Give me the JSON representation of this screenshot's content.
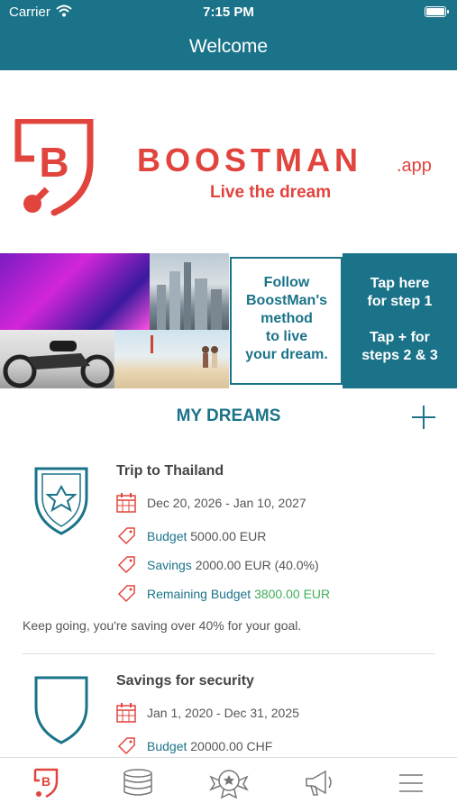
{
  "status_bar": {
    "carrier": "Carrier",
    "time": "7:15 PM"
  },
  "navbar": {
    "title": "Welcome"
  },
  "logo": {
    "brand": "BOOSTMAN",
    "suffix": ".app",
    "tagline": "Live the dream",
    "mark_letter": "B"
  },
  "banner": {
    "follow_lines": [
      "Follow",
      "BoostMan's",
      "method",
      "to live",
      "your dream."
    ],
    "tap_step1": [
      "Tap here",
      "for step 1"
    ],
    "tap_step23": [
      "Tap + for",
      "steps 2 & 3"
    ]
  },
  "dreams": {
    "header": "MY DREAMS",
    "items": [
      {
        "title": "Trip to Thailand",
        "dates": "Dec 20, 2026 - Jan 10, 2027",
        "budget_label": "Budget",
        "budget_value": "5000.00 EUR",
        "savings_label": "Savings",
        "savings_value": "2000.00 EUR (40.0%)",
        "remaining_label": "Remaining Budget",
        "remaining_value": "3800.00 EUR",
        "note": "Keep going, you're saving over 40% for your goal."
      },
      {
        "title": "Savings for security",
        "dates": "Jan 1, 2020 - Dec 31, 2025",
        "budget_label": "Budget",
        "budget_value": "20000.00 CHF"
      }
    ]
  },
  "tabbar": {
    "icons": [
      "boostman-b-icon",
      "coins-icon",
      "medal-icon",
      "megaphone-icon",
      "menu-icon"
    ]
  },
  "colors": {
    "primary": "#1b7389",
    "brand_red": "#e0443d",
    "positive": "#3fae5a"
  }
}
